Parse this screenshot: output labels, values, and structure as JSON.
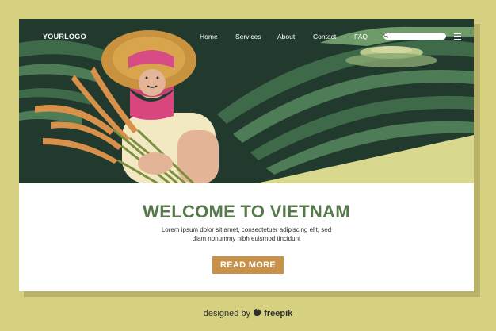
{
  "nav": {
    "logo": "YOURLOGO",
    "links": [
      "Home",
      "Services",
      "About",
      "Contact",
      "FAQ"
    ],
    "search_placeholder": ""
  },
  "hero": {
    "title": "WELCOME TO VIETNAM",
    "body": "Lorem ipsum dolor sit amet, consectetuer adipiscing elit, sed diam nonummy nibh euismod tincidunt",
    "cta": "READ MORE"
  },
  "footer": {
    "credit_prefix": "designed by",
    "credit_brand": "freepik"
  },
  "colors": {
    "background": "#d5d181",
    "hero_dark": "#213a2d",
    "terrace_green": "#3f6a4a",
    "title_green": "#56794b",
    "button": "#c9924b"
  },
  "icons": [
    "search-icon",
    "menu-icon",
    "freepik-logo-icon"
  ]
}
